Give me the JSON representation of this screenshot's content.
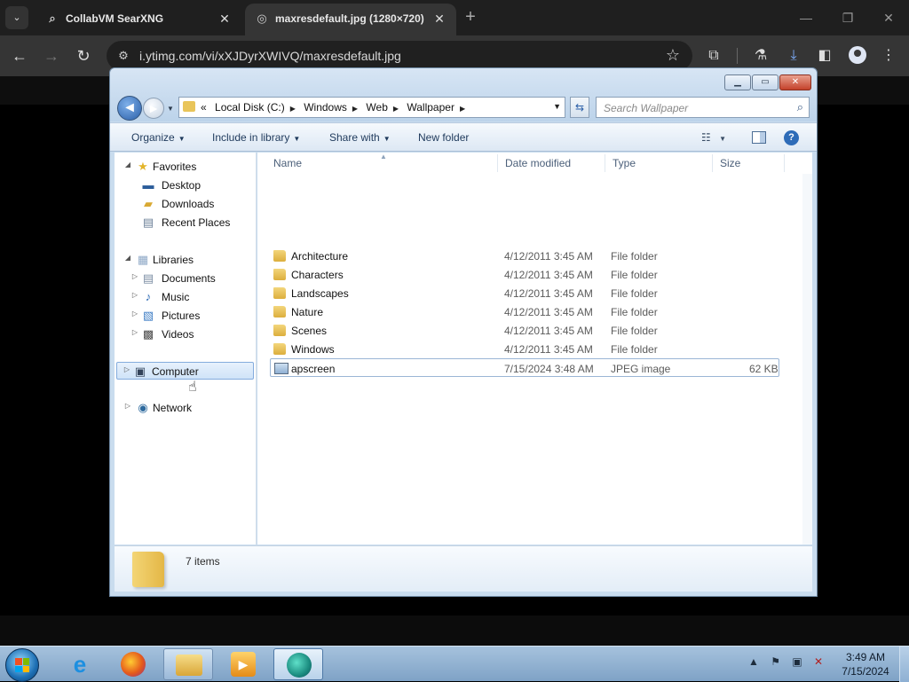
{
  "browser": {
    "tabs": [
      {
        "title": "CollabVM SearXNG",
        "favicon": "search-icon",
        "active": false
      },
      {
        "title": "maxresdefault.jpg (1280×720)",
        "favicon": "globe-icon",
        "active": true
      }
    ],
    "url": "i.ytimg.com/vi/xXJDyrXWIVQ/maxresdefault.jpg",
    "icons": {
      "tab_search": "⌄",
      "close": "✕",
      "new_tab": "+",
      "minimize": "—",
      "restore": "❐",
      "window_close": "✕",
      "back": "←",
      "forward": "→",
      "reload": "↻",
      "site_info": "⚙",
      "bookmark": "☆",
      "extensions": "⧉",
      "labs": "⚗",
      "downloads": "⤓",
      "side_panel": "◧",
      "menu": "⋮"
    }
  },
  "explorer": {
    "address": {
      "prefix": "«",
      "crumbs": [
        "Local Disk (C:)",
        "Windows",
        "Web",
        "Wallpaper"
      ]
    },
    "search_placeholder": "Search Wallpaper",
    "commands": {
      "organize": "Organize",
      "include": "Include in library",
      "share": "Share with",
      "new_folder": "New folder"
    },
    "nav": {
      "favorites": "Favorites",
      "desktop": "Desktop",
      "downloads": "Downloads",
      "recent": "Recent Places",
      "libraries": "Libraries",
      "documents": "Documents",
      "music": "Music",
      "pictures": "Pictures",
      "videos": "Videos",
      "computer": "Computer",
      "network": "Network"
    },
    "columns": {
      "name": "Name",
      "date": "Date modified",
      "type": "Type",
      "size": "Size"
    },
    "files": [
      {
        "name": "Architecture",
        "date": "4/12/2011 3:45 AM",
        "type": "File folder",
        "size": "",
        "kind": "folder"
      },
      {
        "name": "Characters",
        "date": "4/12/2011 3:45 AM",
        "type": "File folder",
        "size": "",
        "kind": "folder"
      },
      {
        "name": "Landscapes",
        "date": "4/12/2011 3:45 AM",
        "type": "File folder",
        "size": "",
        "kind": "folder"
      },
      {
        "name": "Nature",
        "date": "4/12/2011 3:45 AM",
        "type": "File folder",
        "size": "",
        "kind": "folder"
      },
      {
        "name": "Scenes",
        "date": "4/12/2011 3:45 AM",
        "type": "File folder",
        "size": "",
        "kind": "folder"
      },
      {
        "name": "Windows",
        "date": "4/12/2011 3:45 AM",
        "type": "File folder",
        "size": "",
        "kind": "folder"
      },
      {
        "name": "apscreen",
        "date": "7/15/2024 3:48 AM",
        "type": "JPEG image",
        "size": "62 KB",
        "kind": "jpeg"
      }
    ],
    "status": "7 items"
  },
  "taskbar": {
    "apps": [
      "internet-explorer",
      "firefox",
      "windows-explorer",
      "media-player",
      "collabvm-app"
    ],
    "time": "3:49 AM",
    "date": "7/15/2024"
  }
}
